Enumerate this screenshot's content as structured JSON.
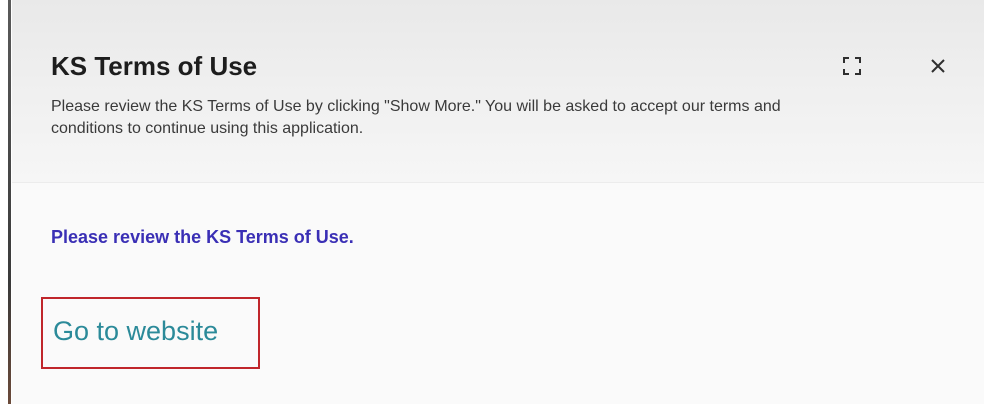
{
  "dialog": {
    "title": "KS Terms of Use",
    "subtitle": "Please review the KS Terms of Use by clicking \"Show More.\" You will be asked to accept our terms and conditions to continue using this application.",
    "buttons": {
      "expand_icon": "expand-icon",
      "close_icon": "close-icon"
    }
  },
  "body": {
    "review_text": "Please review the KS Terms of Use.",
    "website_link": "Go to website"
  },
  "colors": {
    "title": "#1d1d1d",
    "review_text": "#3a2fb5",
    "link": "#2b8a99",
    "highlight_box": "#c0262b"
  }
}
